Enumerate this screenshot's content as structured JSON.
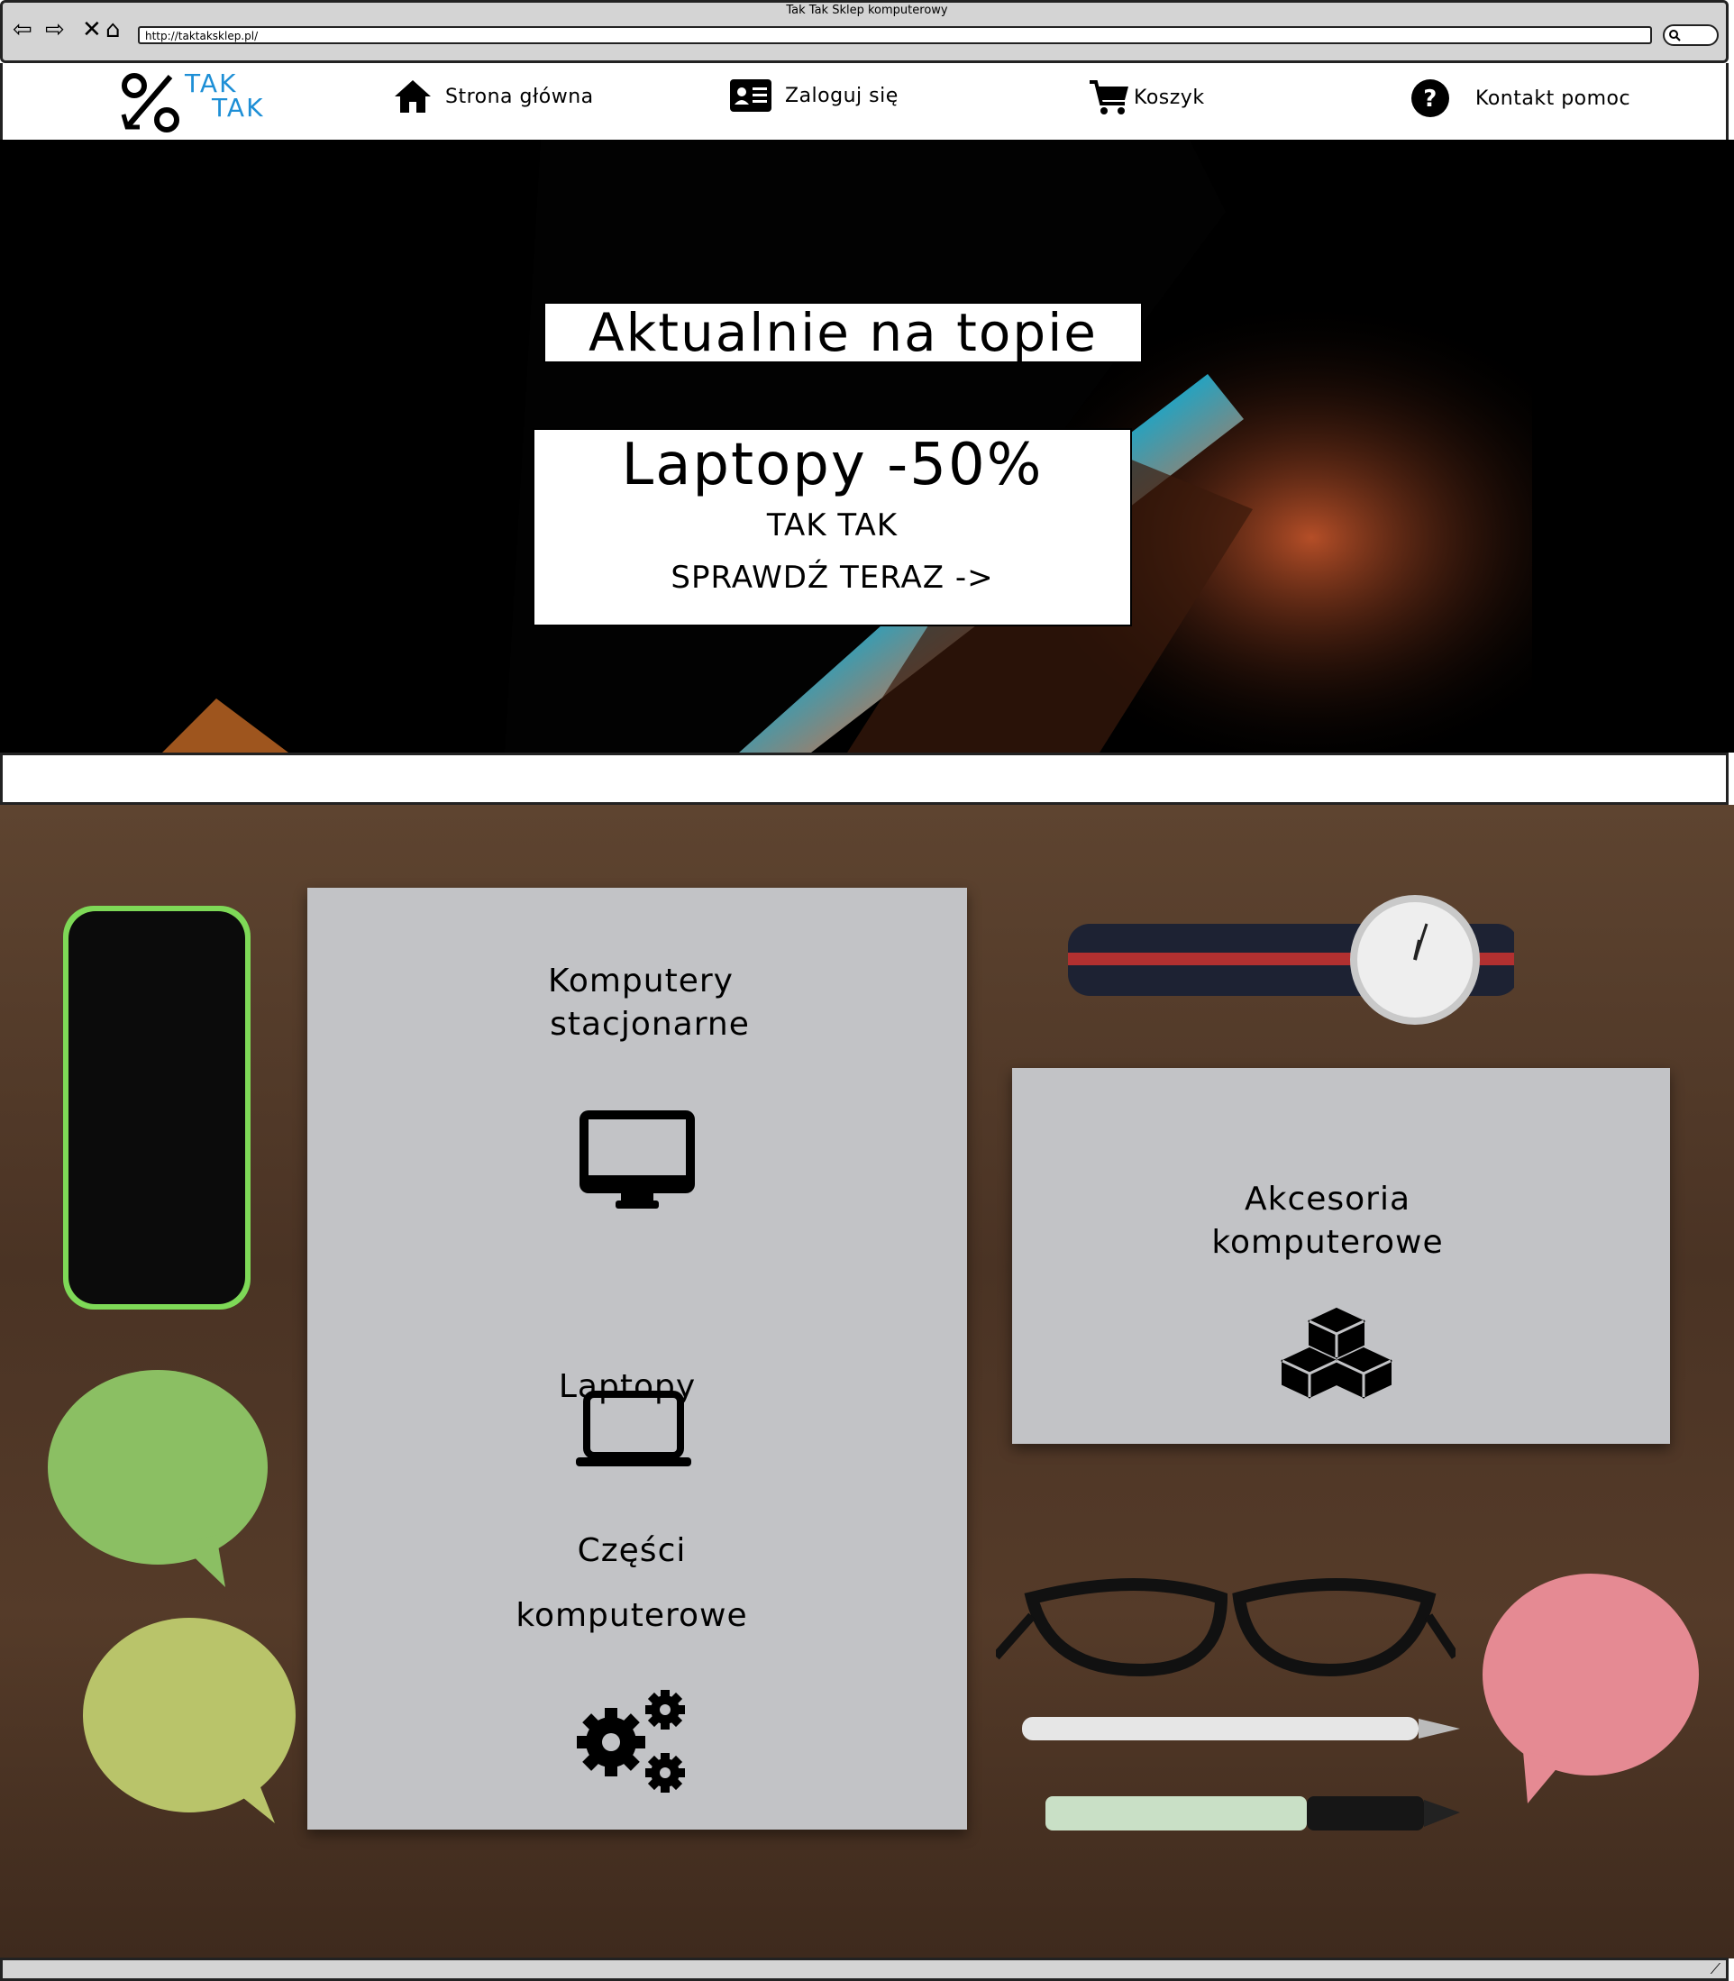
{
  "window": {
    "title": "Tak Tak Sklep komputerowy",
    "url": "http://taktaksklep.pl/"
  },
  "logo": {
    "line1": "TAK",
    "line2": "TAK"
  },
  "nav": {
    "home": "Strona główna",
    "login": "Zaloguj się",
    "cart": "Koszyk",
    "help": "Kontakt pomoc"
  },
  "hero": {
    "headline": "Aktualnie na topie",
    "promo_title": "Laptopy -50%",
    "promo_brand": "TAK TAK",
    "promo_cta": "SPRAWDŹ TERAZ ->"
  },
  "categories": {
    "desktop_l1": "Komputery",
    "desktop_l2": "stacjonarne",
    "laptops": "Laptopy",
    "parts_l1": "Części",
    "parts_l2": "komputerowe",
    "accessories_l1": "Akcesoria",
    "accessories_l2": "komputerowe"
  },
  "icons": [
    "back-arrow-icon",
    "forward-arrow-icon",
    "close-icon",
    "home-icon",
    "search-icon",
    "id-card-icon",
    "cart-icon",
    "question-icon",
    "monitor-icon",
    "laptop-icon",
    "gears-icon",
    "cubes-icon"
  ]
}
